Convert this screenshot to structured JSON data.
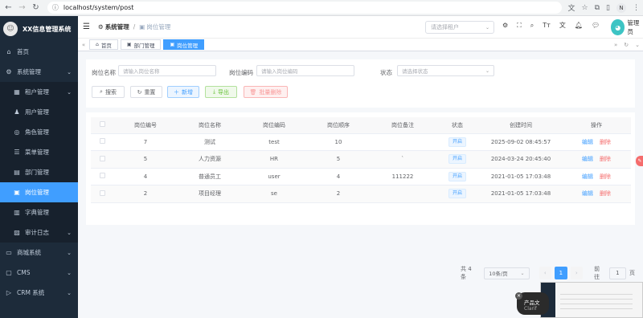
{
  "browser": {
    "url": "localhost/system/post",
    "profile_initial": "N"
  },
  "sidebar": {
    "brand": "XX信息管理系统",
    "items": [
      {
        "label": "首页",
        "icon": "home-icon",
        "level": 0,
        "active": false,
        "has_arrow": false
      },
      {
        "label": "系统管理",
        "icon": "gear-icon",
        "level": 0,
        "active": false,
        "has_arrow": true
      },
      {
        "label": "租户管理",
        "icon": "building-icon",
        "level": 1,
        "active": false,
        "has_arrow": true
      },
      {
        "label": "用户管理",
        "icon": "user-icon",
        "level": 1,
        "active": false,
        "has_arrow": false
      },
      {
        "label": "角色管理",
        "icon": "role-icon",
        "level": 1,
        "active": false,
        "has_arrow": false
      },
      {
        "label": "菜单管理",
        "icon": "menu-icon",
        "level": 1,
        "active": false,
        "has_arrow": false
      },
      {
        "label": "部门管理",
        "icon": "dept-icon",
        "level": 1,
        "active": false,
        "has_arrow": false
      },
      {
        "label": "岗位管理",
        "icon": "post-icon",
        "level": 1,
        "active": true,
        "has_arrow": false
      },
      {
        "label": "字典管理",
        "icon": "dict-icon",
        "level": 1,
        "active": false,
        "has_arrow": false
      },
      {
        "label": "审计日志",
        "icon": "log-icon",
        "level": 1,
        "active": false,
        "has_arrow": true
      },
      {
        "label": "商城系统",
        "icon": "shop-icon",
        "level": 0,
        "active": false,
        "has_arrow": true
      },
      {
        "label": "CMS",
        "icon": "cms-icon",
        "level": 0,
        "active": false,
        "has_arrow": true
      },
      {
        "label": "CRM 系统",
        "icon": "crm-icon",
        "level": 0,
        "active": false,
        "has_arrow": true
      }
    ]
  },
  "navbar": {
    "breadcrumb_root": "系统管理",
    "breadcrumb_current": "岗位管理",
    "tenant_placeholder": "请选择租户",
    "user_name": "管理员"
  },
  "tags": [
    {
      "label": "首页",
      "active": false
    },
    {
      "label": "部门管理",
      "active": false
    },
    {
      "label": "岗位管理",
      "active": true
    }
  ],
  "search": {
    "post_name_label": "岗位名称",
    "post_name_placeholder": "请输入岗位名称",
    "post_code_label": "岗位编码",
    "post_code_placeholder": "请输入岗位编码",
    "status_label": "状态",
    "status_placeholder": "请选择状态",
    "search_btn": "搜索",
    "reset_btn": "重置",
    "add_btn": "新增",
    "export_btn": "导出",
    "batch_delete_btn": "批量删除"
  },
  "table": {
    "columns": [
      "岗位编号",
      "岗位名称",
      "岗位编码",
      "岗位顺序",
      "岗位备注",
      "状态",
      "创建时间",
      "操作"
    ],
    "rows": [
      {
        "id": "7",
        "name": "测试",
        "code": "test",
        "sort": "10",
        "remark": "",
        "status": "开启",
        "created": "2025-09-02 08:45:57"
      },
      {
        "id": "5",
        "name": "人力资源",
        "code": "HR",
        "sort": "5",
        "remark": "`",
        "status": "开启",
        "created": "2024-03-24 20:45:40"
      },
      {
        "id": "4",
        "name": "普通员工",
        "code": "user",
        "sort": "4",
        "remark": "111222",
        "status": "开启",
        "created": "2021-01-05 17:03:48"
      },
      {
        "id": "2",
        "name": "项目经理",
        "code": "se",
        "sort": "2",
        "remark": "",
        "status": "开启",
        "created": "2021-01-05 17:03:48"
      }
    ],
    "edit_label": "编辑",
    "delete_label": "删除"
  },
  "pagination": {
    "total": "共 4 条",
    "page_size": "10条/页",
    "current_page": "1",
    "goto_label": "前往",
    "goto_value": "1",
    "goto_unit": "页"
  },
  "float_widget": {
    "title": "产品文",
    "subtitle": "Clarif"
  },
  "colors": {
    "primary": "#409eff",
    "sidebar_bg": "#1d2b3a",
    "danger": "#f56c6c",
    "success": "#67c23a"
  }
}
